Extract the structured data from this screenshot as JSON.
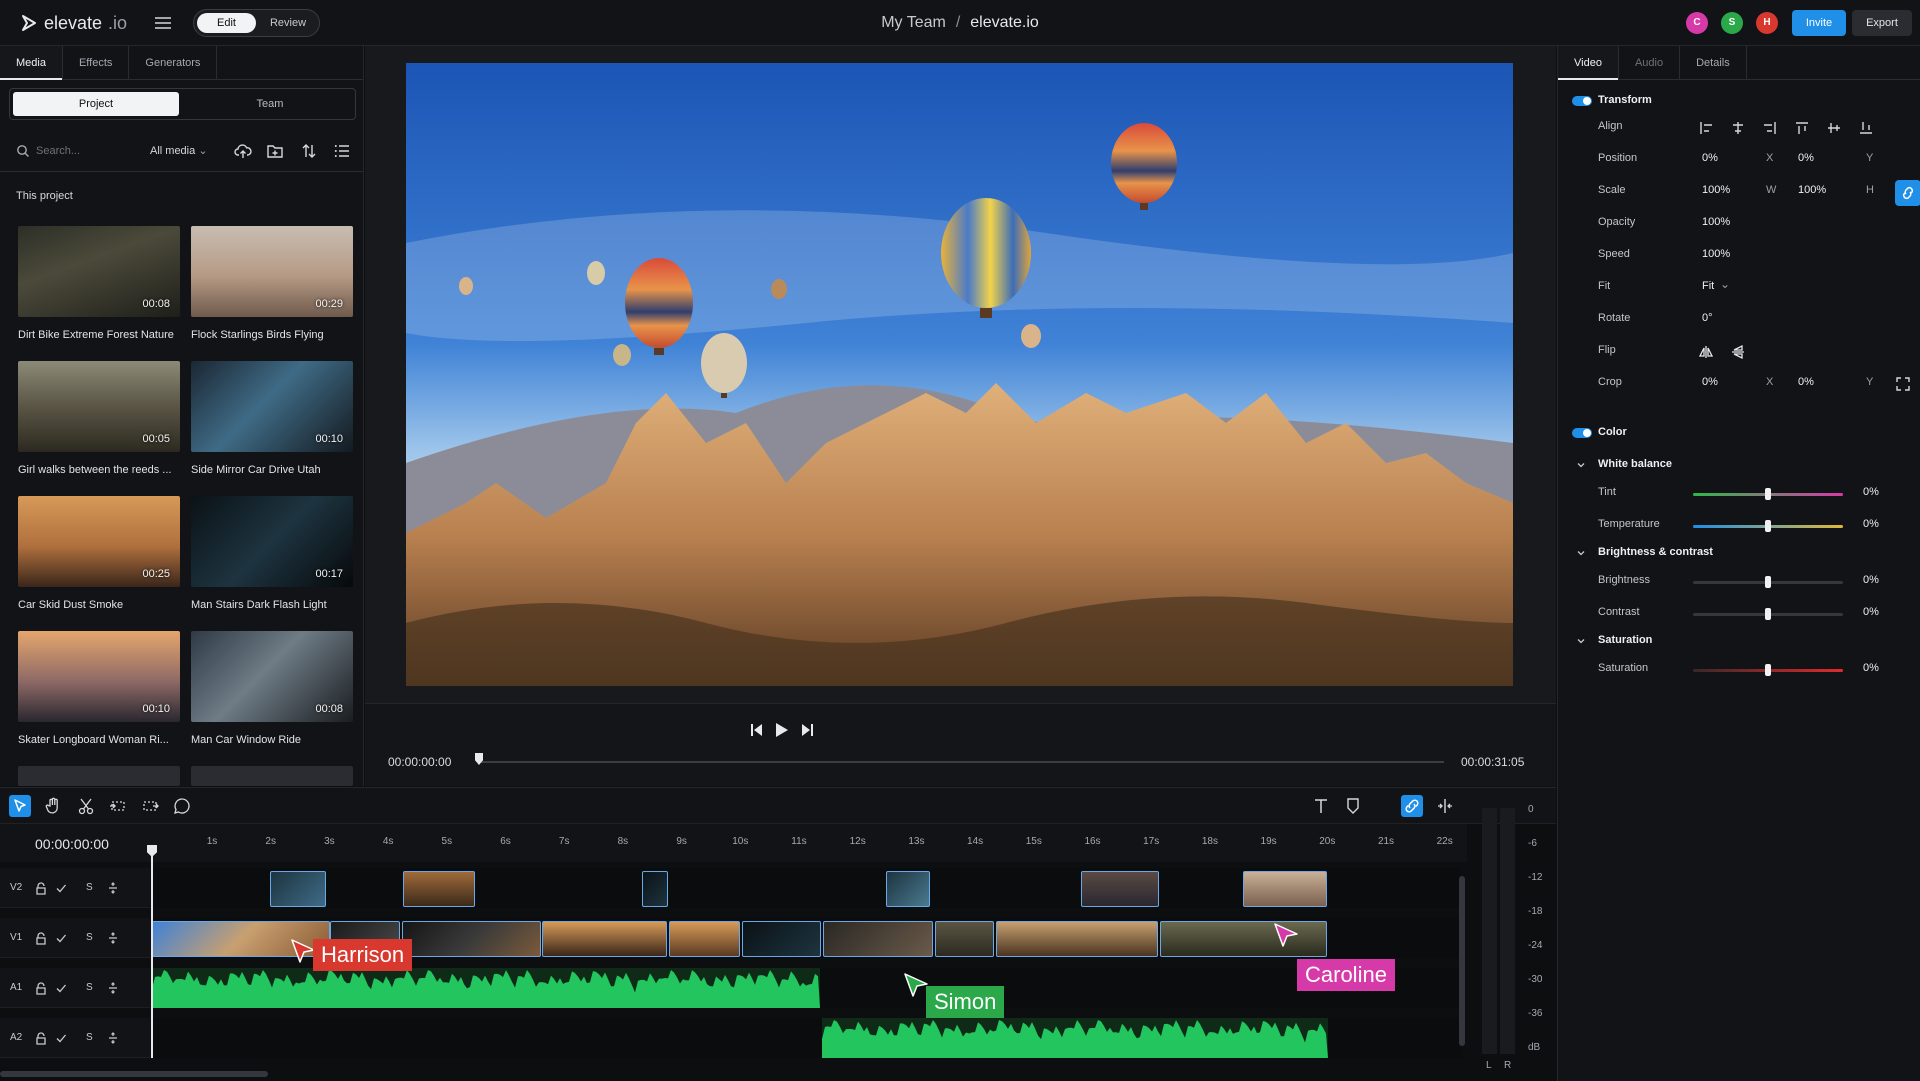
{
  "app": {
    "logo_text": "elevate",
    "logo_suffix": ".io",
    "mode_edit": "Edit",
    "mode_review": "Review",
    "breadcrumb_team": "My Team",
    "breadcrumb_sep": "/",
    "breadcrumb_project": "elevate.io",
    "avatars": [
      {
        "letter": "C",
        "color": "#d63aa8"
      },
      {
        "letter": "S",
        "color": "#2aa84a"
      },
      {
        "letter": "H",
        "color": "#d9382f"
      }
    ],
    "invite_label": "Invite",
    "export_label": "Export"
  },
  "left": {
    "tabs": [
      "Media",
      "Effects",
      "Generators"
    ],
    "scope_project": "Project",
    "scope_team": "Team",
    "search_placeholder": "Search...",
    "filter_label": "All media",
    "section_title": "This project",
    "clips": [
      {
        "name": "Dirt Bike Extreme Forest Nature",
        "duration": "00:08",
        "bg": "linear-gradient(160deg,#2d2f27 0%,#4b4a3a 40%,#1e1f1a 100%)"
      },
      {
        "name": "Flock Starlings Birds Flying",
        "duration": "00:29",
        "bg": "linear-gradient(180deg,#c7bdb0 0%,#b69a85 55%,#6f5a4c 100%)"
      },
      {
        "name": "Girl walks between the reeds ...",
        "duration": "00:05",
        "bg": "linear-gradient(180deg,#8c8a78 0%,#5a5544 50%,#2c2a20 100%)"
      },
      {
        "name": "Side Mirror Car Drive Utah",
        "duration": "00:10",
        "bg": "linear-gradient(135deg,#1b2733 0%,#3f6b86 45%,#141a20 100%)"
      },
      {
        "name": "Car Skid Dust Smoke",
        "duration": "00:25",
        "bg": "linear-gradient(180deg,#d79a58 0%,#b0703e 55%,#3a261a 100%)"
      },
      {
        "name": "Man Stairs Dark Flash Light",
        "duration": "00:17",
        "bg": "linear-gradient(135deg,#0b1216 0%,#1d3440 50%,#07090b 100%)"
      },
      {
        "name": "Skater Longboard Woman Ri...",
        "duration": "00:10",
        "bg": "linear-gradient(180deg,#e5a66d 0%,#8e6a66 55%,#2a2730 100%)"
      },
      {
        "name": "Man Car Window Ride",
        "duration": "00:08",
        "bg": "linear-gradient(135deg,#2f3a45 0%,#6e7c86 45%,#1a1d20 100%)"
      }
    ]
  },
  "viewer": {
    "timecode_start": "00:00:00:00",
    "timecode_end": "00:00:31:05"
  },
  "inspector": {
    "tabs": [
      "Video",
      "Audio",
      "Details"
    ],
    "transform_title": "Transform",
    "rows": [
      {
        "label": "Align"
      },
      {
        "label": "Position",
        "v1": "0%",
        "a1": "X",
        "v2": "0%",
        "a2": "Y"
      },
      {
        "label": "Scale",
        "v1": "100%",
        "a1": "W",
        "v2": "100%",
        "a2": "H"
      },
      {
        "label": "Opacity",
        "v1": "100%"
      },
      {
        "label": "Speed",
        "v1": "100%"
      },
      {
        "label": "Fit",
        "v1": "Fit"
      },
      {
        "label": "Rotate",
        "v1": "0°"
      },
      {
        "label": "Flip"
      },
      {
        "label": "Crop",
        "v1": "0%",
        "a1": "X",
        "v2": "0%",
        "a2": "Y"
      }
    ],
    "color_title": "Color",
    "groups": [
      {
        "title": "White balance",
        "sliders": [
          {
            "label": "Tint",
            "value": "0%",
            "level": 0.5,
            "track": "linear-gradient(90deg,#2fb84a,#d63aa8)"
          },
          {
            "label": "Temperature",
            "value": "0%",
            "level": 0.5,
            "track": "linear-gradient(90deg,#1f8fe8,#e0b93a)"
          }
        ]
      },
      {
        "title": "Brightness & contrast",
        "sliders": [
          {
            "label": "Brightness",
            "value": "0%",
            "level": 0.5,
            "track": "#34373d"
          },
          {
            "label": "Contrast",
            "value": "0%",
            "level": 0.5,
            "track": "#34373d"
          }
        ]
      },
      {
        "title": "Saturation",
        "sliders": [
          {
            "label": "Saturation",
            "value": "0%",
            "level": 0.5,
            "track": "linear-gradient(90deg,#3a2727,#e12a2a)"
          }
        ]
      }
    ]
  },
  "timeline": {
    "timecode": "00:00:00:00",
    "ticks": [
      "1s",
      "2s",
      "3s",
      "4s",
      "5s",
      "6s",
      "7s",
      "8s",
      "9s",
      "10s",
      "11s",
      "12s",
      "13s",
      "14s",
      "15s",
      "16s",
      "17s",
      "18s",
      "19s",
      "20s",
      "21s",
      "22s"
    ],
    "tracks": [
      {
        "name": "V2",
        "s": "S"
      },
      {
        "name": "V1",
        "s": "S"
      },
      {
        "name": "A1",
        "s": "S"
      },
      {
        "name": "A2",
        "s": "S"
      }
    ],
    "collaborators": [
      {
        "name": "Harrison",
        "color": "#d9382f"
      },
      {
        "name": "Simon",
        "color": "#2aa84a"
      },
      {
        "name": "Caroline",
        "color": "#d63aa8"
      }
    ],
    "meter_labels": [
      "0",
      "-6",
      "-12",
      "-18",
      "-24",
      "-30",
      "-36",
      "dB"
    ],
    "meter_channels": [
      "L",
      "R"
    ]
  }
}
